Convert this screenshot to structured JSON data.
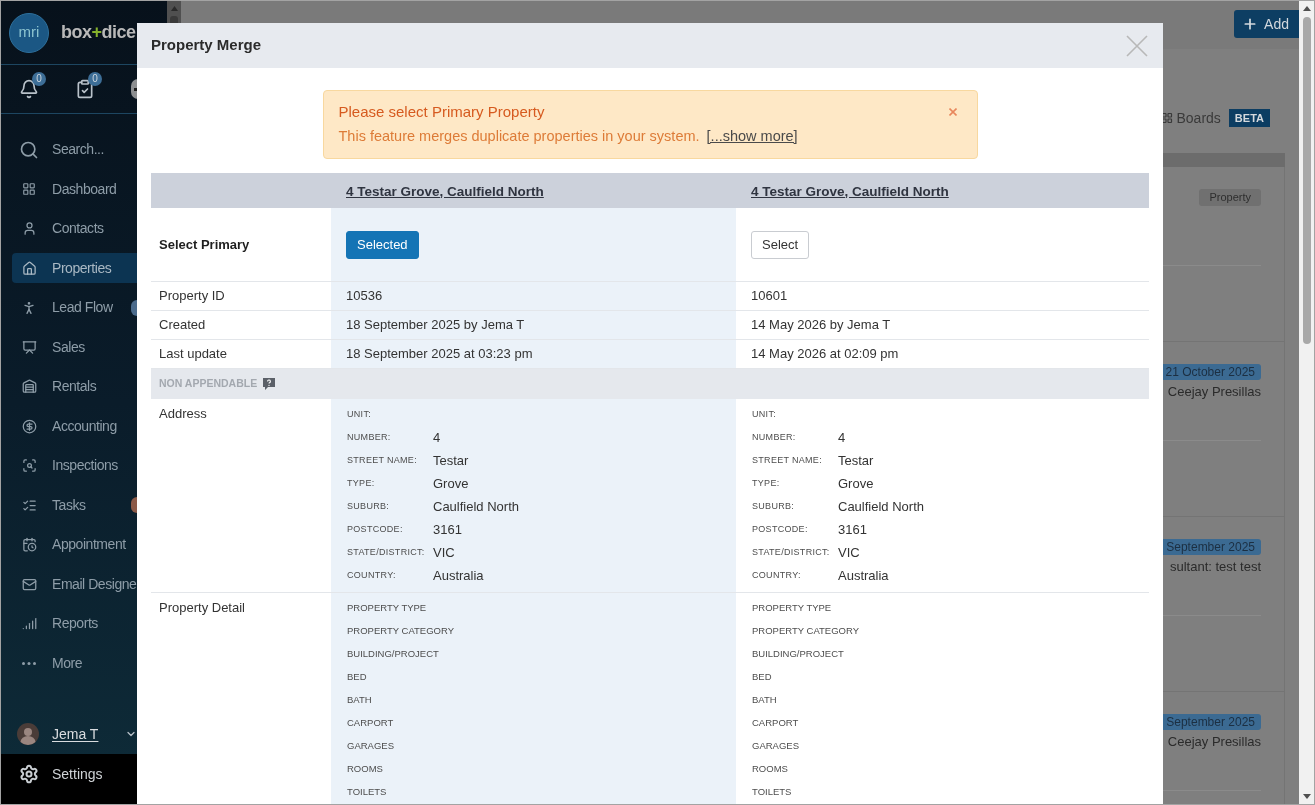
{
  "sidebar": {
    "logo": {
      "badge": "mri",
      "wordmark": [
        "box",
        "+",
        "dice"
      ]
    },
    "notifications": [
      {
        "kind": "bell",
        "count": "0"
      },
      {
        "kind": "tasks",
        "count": "0"
      },
      {
        "kind": "circle"
      }
    ],
    "items": [
      {
        "kind": "search",
        "label": "Search...",
        "selected": false
      },
      {
        "kind": "dashboard",
        "label": "Dashboard",
        "selected": false
      },
      {
        "kind": "contacts",
        "label": "Contacts",
        "selected": false
      },
      {
        "kind": "properties",
        "label": "Properties",
        "selected": true
      },
      {
        "kind": "leadflow",
        "label": "Lead Flow",
        "selected": false,
        "badge": {
          "color": "#4b6b8c"
        }
      },
      {
        "kind": "sales",
        "label": "Sales",
        "selected": false
      },
      {
        "kind": "rentals",
        "label": "Rentals",
        "selected": false
      },
      {
        "kind": "accounting",
        "label": "Accounting",
        "selected": false
      },
      {
        "kind": "inspections",
        "label": "Inspections",
        "selected": false
      },
      {
        "kind": "tasks",
        "label": "Tasks",
        "selected": false,
        "badge": {
          "color": "#8c5a48"
        }
      },
      {
        "kind": "appointments",
        "label": "Appointment",
        "selected": false
      },
      {
        "kind": "email",
        "label": "Email Designe",
        "selected": false
      },
      {
        "kind": "reports",
        "label": "Reports",
        "selected": false
      },
      {
        "kind": "more",
        "label": "More",
        "selected": false
      }
    ],
    "user": {
      "name": "Jema T"
    },
    "settings": {
      "label": "Settings"
    }
  },
  "page": {
    "add_button": "Add",
    "boards": {
      "label": "Boards",
      "badge": "BETA"
    },
    "cards": [
      {
        "kind": "tag",
        "tag": "Property"
      },
      {
        "kind": "event",
        "date": "21 October 2025",
        "line": "Ceejay Presillas"
      },
      {
        "kind": "event",
        "date": "September 2025",
        "line": "sultant: test test"
      },
      {
        "kind": "event",
        "date": "September 2025",
        "line": "Ceejay Presillas"
      }
    ]
  },
  "modal": {
    "title": "Property Merge",
    "alert": {
      "title": "Please select Primary Property",
      "text": "This feature merges duplicate properties in your system.",
      "link": "[...show more]"
    },
    "columns": [
      {
        "heading": "4 Testar Grove, Caulfield North",
        "selected": true,
        "button": "Selected"
      },
      {
        "heading": "4 Testar Grove, Caulfield North",
        "selected": false,
        "button": "Select"
      }
    ],
    "select_label": "Select Primary",
    "rows": [
      {
        "label": "Property ID",
        "values": [
          "10536",
          "10601"
        ]
      },
      {
        "label": "Created",
        "values": [
          "18 September 2025 by Jema T",
          "14 May 2026 by Jema T"
        ]
      },
      {
        "label": "Last update",
        "values": [
          "18 September 2025 at 03:23 pm",
          "14 May 2026 at 02:09 pm"
        ]
      }
    ],
    "section": "NON APPENDABLE",
    "groups": [
      {
        "kind": "fields",
        "label": "Address",
        "columns": [
          [
            {
              "name": "UNIT:"
            },
            {
              "name": "NUMBER:",
              "value": "4"
            },
            {
              "name": "STREET NAME:",
              "value": "Testar"
            },
            {
              "name": "TYPE:",
              "value": "Grove"
            },
            {
              "name": "SUBURB:",
              "value": "Caulfield North"
            },
            {
              "name": "POSTCODE:",
              "value": "3161"
            },
            {
              "name": "STATE/DISTRICT:",
              "value": "VIC"
            },
            {
              "name": "COUNTRY:",
              "value": "Australia"
            }
          ],
          [
            {
              "name": "UNIT:"
            },
            {
              "name": "NUMBER:",
              "value": "4"
            },
            {
              "name": "STREET NAME:",
              "value": "Testar"
            },
            {
              "name": "TYPE:",
              "value": "Grove"
            },
            {
              "name": "SUBURB:",
              "value": "Caulfield North"
            },
            {
              "name": "POSTCODE:",
              "value": "3161"
            },
            {
              "name": "STATE/DISTRICT:",
              "value": "VIC"
            },
            {
              "name": "COUNTRY:",
              "value": "Australia"
            }
          ]
        ]
      },
      {
        "kind": "list",
        "label": "Property Detail",
        "columns": [
          [
            {
              "name": "PROPERTY TYPE"
            },
            {
              "name": "PROPERTY CATEGORY"
            },
            {
              "name": "BUILDING/PROJECT"
            },
            {
              "name": "BED"
            },
            {
              "name": "BATH"
            },
            {
              "name": "CARPORT"
            },
            {
              "name": "GARAGES"
            },
            {
              "name": "ROOMS"
            },
            {
              "name": "TOILETS"
            }
          ],
          [
            {
              "name": "PROPERTY TYPE"
            },
            {
              "name": "PROPERTY CATEGORY"
            },
            {
              "name": "BUILDING/PROJECT"
            },
            {
              "name": "BED"
            },
            {
              "name": "BATH"
            },
            {
              "name": "CARPORT"
            },
            {
              "name": "GARAGES"
            },
            {
              "name": "ROOMS"
            },
            {
              "name": "TOILETS"
            }
          ]
        ]
      }
    ]
  }
}
